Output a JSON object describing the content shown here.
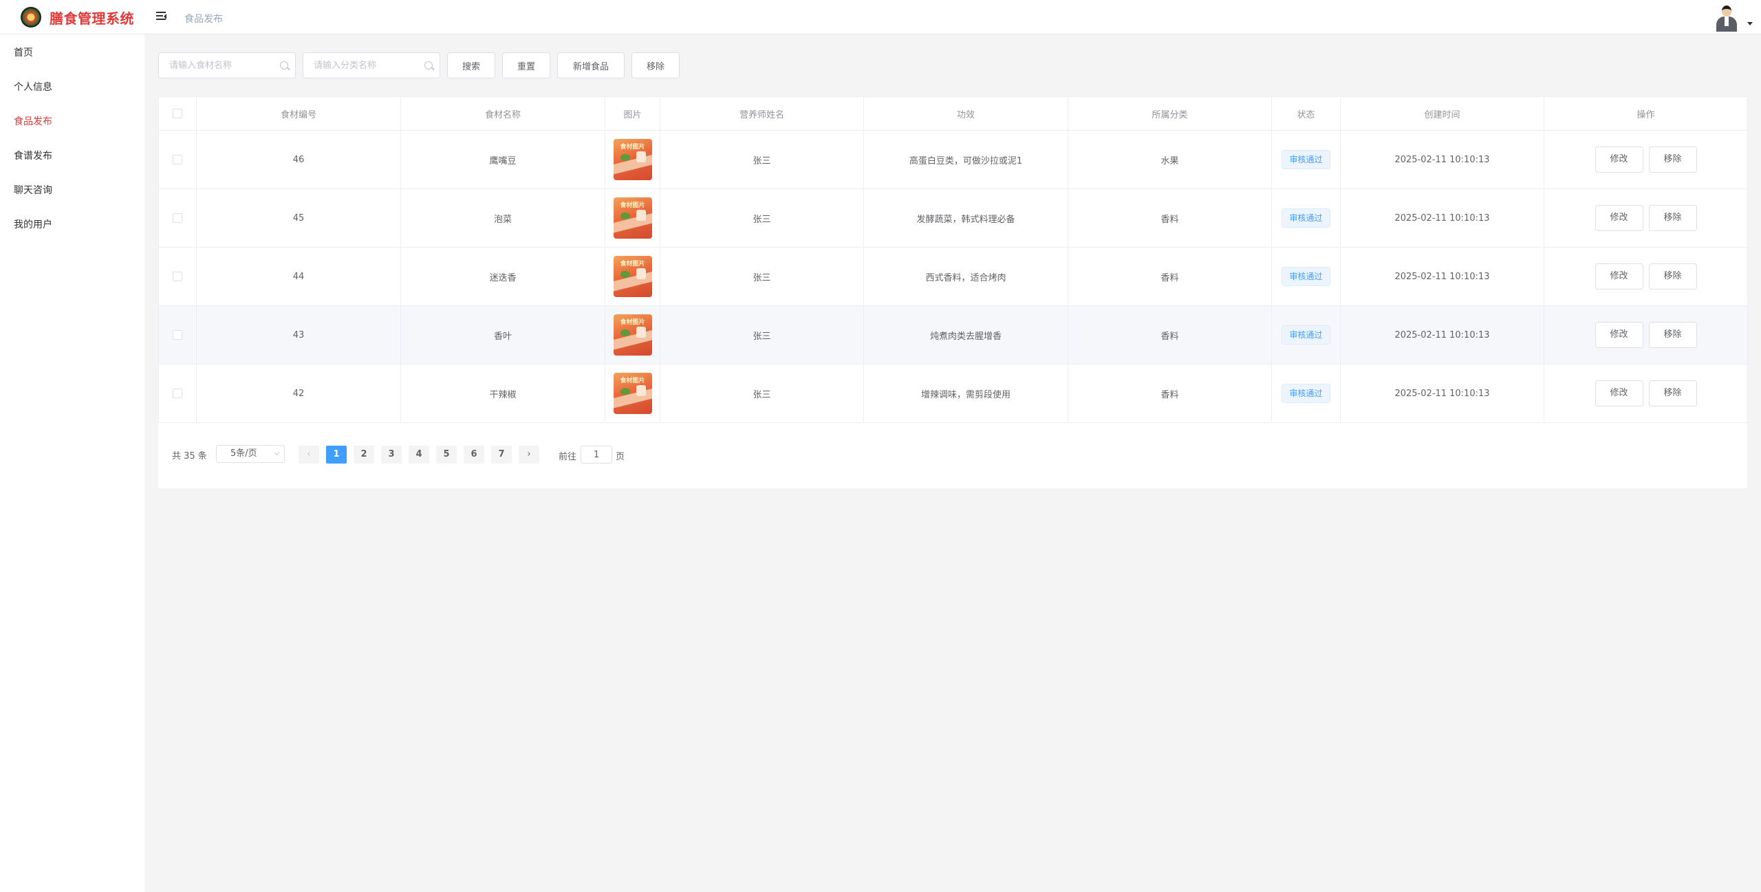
{
  "app": {
    "title": "膳食管理系统"
  },
  "breadcrumb": "食品发布",
  "sidebar": {
    "items": [
      {
        "label": "首页",
        "active": false
      },
      {
        "label": "个人信息",
        "active": false
      },
      {
        "label": "食品发布",
        "active": true
      },
      {
        "label": "食谱发布",
        "active": false
      },
      {
        "label": "聊天咨询",
        "active": false
      },
      {
        "label": "我的用户",
        "active": false
      }
    ]
  },
  "toolbar": {
    "name_placeholder": "请输入食材名称",
    "category_placeholder": "请输入分类名称",
    "search_label": "搜索",
    "reset_label": "重置",
    "add_label": "新增食品",
    "remove_label": "移除"
  },
  "table": {
    "columns": [
      "食材编号",
      "食材名称",
      "图片",
      "营养师姓名",
      "功效",
      "所属分类",
      "状态",
      "创建时间",
      "操作"
    ],
    "image_caption": "食材图片",
    "edit_label": "修改",
    "delete_label": "移除",
    "rows": [
      {
        "id": "46",
        "name": "鹰嘴豆",
        "nutritionist": "张三",
        "effect": "高蛋白豆类，可做沙拉或泥1",
        "category": "水果",
        "status": "审核通过",
        "created": "2025-02-11 10:10:13"
      },
      {
        "id": "45",
        "name": "泡菜",
        "nutritionist": "张三",
        "effect": "发酵蔬菜，韩式料理必备",
        "category": "香料",
        "status": "审核通过",
        "created": "2025-02-11 10:10:13"
      },
      {
        "id": "44",
        "name": "迷迭香",
        "nutritionist": "张三",
        "effect": "西式香料，适合烤肉",
        "category": "香料",
        "status": "审核通过",
        "created": "2025-02-11 10:10:13"
      },
      {
        "id": "43",
        "name": "香叶",
        "nutritionist": "张三",
        "effect": "炖煮肉类去腥增香",
        "category": "香料",
        "status": "审核通过",
        "created": "2025-02-11 10:10:13"
      },
      {
        "id": "42",
        "name": "干辣椒",
        "nutritionist": "张三",
        "effect": "增辣调味，需剪段使用",
        "category": "香料",
        "status": "审核通过",
        "created": "2025-02-11 10:10:13"
      }
    ]
  },
  "pagination": {
    "total_text": "共 35 条",
    "page_size": "5条/页",
    "pages": [
      "1",
      "2",
      "3",
      "4",
      "5",
      "6",
      "7"
    ],
    "current": "1",
    "goto_prefix": "前往",
    "goto_value": "1",
    "goto_suffix": "页"
  },
  "colors": {
    "accent": "#409eff",
    "brand": "#e03a3a"
  }
}
